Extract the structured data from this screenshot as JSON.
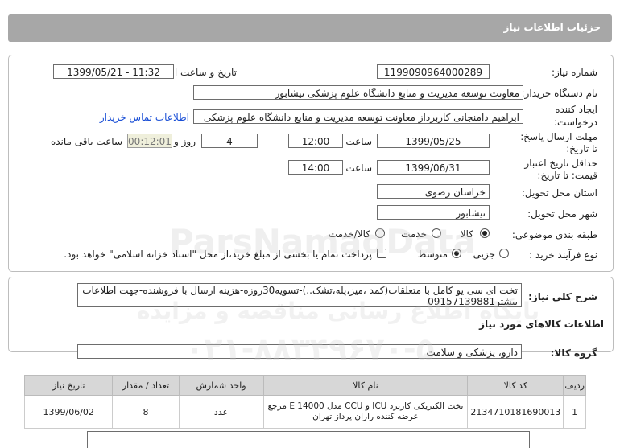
{
  "page_title": "جزئیات اطلاعات نیاز",
  "fields": {
    "need_number_label": "شماره نیاز:",
    "need_number": "1199090964000289",
    "announce_label": "تاریخ و ساعت اعلان عمومی:",
    "announce_value": "1399/05/21 - 11:32",
    "buyer_label": "نام دستگاه خریدار:",
    "buyer_value": "معاونت توسعه مدیریت و منابع دانشگاه علوم پزشکی نیشابور",
    "creator_label_1": "ایجاد کننده",
    "creator_label_2": "درخواست:",
    "creator_value": "ابراهیم دامنجانی  کاربرداز معاونت توسعه مدیریت و منابع دانشگاه علوم پزشکی",
    "contact_link": "اطلاعات تماس خریدار",
    "deadline_label_1": "مهلت ارسال پاسخ:",
    "deadline_label_2": "تا تاریخ:",
    "deadline_date": "1399/05/25",
    "time_word": "ساعت",
    "deadline_time": "12:00",
    "days_value": "4",
    "days_word": "روز و",
    "remaining_time": "00:12:01",
    "remaining_label": "ساعت باقی مانده",
    "validity_label_1": "حداقل تاریخ اعتبار",
    "validity_label_2": "قیمت: تا تاریخ:",
    "validity_date": "1399/06/31",
    "validity_time": "14:00",
    "province_label": "استان محل تحویل:",
    "province_value": "خراسان رضوی",
    "city_label": "شهر محل تحویل:",
    "city_value": "نیشابور",
    "category_label": "طبقه بندی موضوعی:",
    "category_options": [
      "کالا",
      "خدمت",
      "کالا/خدمت"
    ],
    "process_label": "نوع فرآیند خرید :",
    "process_options": [
      "جزیی",
      "متوسط"
    ],
    "payment_note": "پرداخت تمام یا بخشی از مبلغ خرید،از محل \"اسناد خزانه اسلامی\" خواهد بود."
  },
  "description": {
    "label": "شرح کلی نیاز:",
    "text": "تخت ای سی یو کامل با متعلقات(کمد ،میز،پله،تشک..)-تسویه30روزه-هزینه ارسال با فروشنده-جهت اطلاعات بیشتر09157139881"
  },
  "goods_section_title": "اطلاعات کالاهای مورد نیاز",
  "goods_group_label": "گروه کالا:",
  "goods_group_value": "دارو، پزشکی و سلامت",
  "table": {
    "headers": [
      "ردیف",
      "کد کالا",
      "نام کالا",
      "واحد شمارش",
      "تعداد / مقدار",
      "تاریخ نیاز"
    ],
    "rows": [
      [
        "1",
        "2134710181690013",
        "تخت الکتریکی کاربرد ICU و CCU مدل E 14000 مرجع عرضه کننده رازان پرداز تهران",
        "عدد",
        "8",
        "1399/06/02"
      ]
    ]
  },
  "watermark": {
    "brand": "ParsNamadData",
    "line1": "پایگاه اطلاع رسانی مناقصه و مزایده",
    "phone": "۰۲۱-۸۸۳۴۹۶۷۰-۵"
  }
}
